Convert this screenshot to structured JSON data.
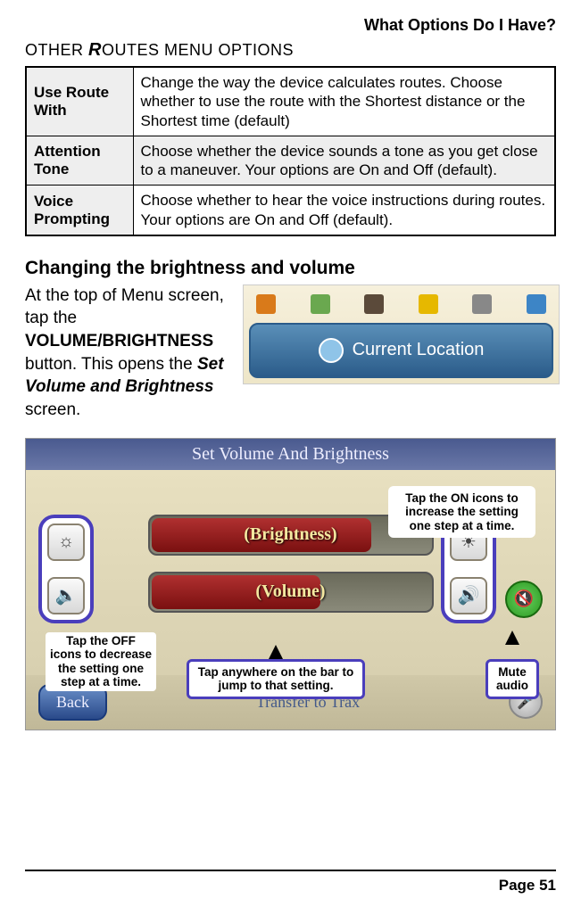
{
  "header": {
    "title": "What Options Do I Have?"
  },
  "section": {
    "other_routes_heading_pre": "O",
    "other_routes_heading_sc1": "THER",
    "other_routes_heading_ital": "R",
    "other_routes_heading_sc2": "OUTES",
    "other_routes_heading_post": " MENU OPTIONS"
  },
  "routes_table": [
    {
      "label": "Use Route With",
      "desc": "Change the way the device calculates routes. Choose whether to use the route with the Shortest distance or the  Shortest time (default)"
    },
    {
      "label": "Attention Tone",
      "desc": "Choose whether the device sounds a tone as you get close to a maneuver. Your options are On and Off (default)."
    },
    {
      "label": "Voice Prompting",
      "desc": "Choose whether to hear the voice instructions during routes. Your options are On and Off (default)."
    }
  ],
  "subheading": "Changing the brightness and volume",
  "intro": {
    "p1a": "At the top of Menu screen, tap the ",
    "p1b": "VOLUME/BRIGHTNESS",
    "p1c": " button. This opens the ",
    "p1d": "Set Volume and Brightness",
    "p1e": " screen."
  },
  "cl_button": "Current Location",
  "svb": {
    "title": "Set Volume And Brightness",
    "brightness_label": "(Brightness)",
    "volume_label": "(Volume)",
    "back": "Back",
    "transfer": "Transfer to Trax"
  },
  "callouts": {
    "on": "Tap the ON icons to increase the setting one step at a time.",
    "off": "Tap the OFF icons to decrease the setting one step at a time.",
    "bar": "Tap anywhere on the bar to jump to that setting.",
    "mute": "Mute audio"
  },
  "footer": {
    "page": "Page 51"
  }
}
